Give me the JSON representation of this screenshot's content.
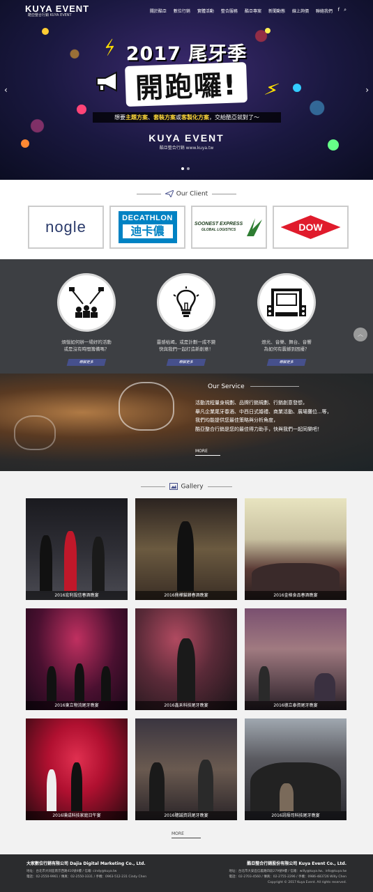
{
  "nav": {
    "logo": "KUYA EVENT",
    "logo_sub": "酷亞整合行銷 KUYA EVENT",
    "items": [
      "關於酷亞",
      "數位行銷",
      "實體活動",
      "整合服務",
      "酷亞專案",
      "新聞動態",
      "線上詢價",
      "聯絡我們"
    ],
    "icons": [
      "facebook-icon",
      "search-icon"
    ]
  },
  "hero": {
    "title": "2017 尾牙季",
    "big": "開跑囉!",
    "strip_pre": "想要",
    "strip_hl1": "主題方案",
    "strip_sep1": "、",
    "strip_hl2": "套裝方案",
    "strip_mid": "或",
    "strip_hl3": "客製化方案",
    "strip_post": "，交給酷亞就對了～",
    "brand": "KUYA EVENT",
    "brand_sub": "酷亞整合行銷 www.kuya.tw",
    "prev": "‹",
    "next": "›"
  },
  "client": {
    "title": "Our Client",
    "logos": {
      "nogle": "nogle",
      "deca_top": "DECATHLON",
      "deca_bottom": "迪卡儂",
      "soonest_1": "SOONEST EXPRESS",
      "soonest_2": "GLOBAL LOGISTICS",
      "dow": "DOW"
    }
  },
  "features": [
    {
      "desc1": "煩惱如何辦一場好的活動",
      "desc2": "或是沒有時間籌備嗎？",
      "btn": "瞭解更多"
    },
    {
      "desc1": "靈感枯竭，或是計劃一成不變",
      "desc2": "快與我們一起打造新創意！",
      "btn": "瞭解更多"
    },
    {
      "desc1": "燈光、音樂、舞台、音響",
      "desc2": "為如何有震撼到困擾？",
      "btn": "瞭解更多"
    }
  ],
  "service": {
    "title": "Our Service",
    "lines": [
      "活動流程量身規劃、品牌行銷規劃、行銷創意發想，",
      "舉凡企業尾牙春酒、中西日式婚禮、商業活動、展場攤位...等，",
      "我們均能提供您最佳策略與分析角度，",
      "酷亞整合行銷是您的最佳得力助手，快與我們一起同樂吧！"
    ],
    "more": "MORE"
  },
  "gallery": {
    "title": "Gallery",
    "items": [
      "2016宏利投信春酒晚宴",
      "2016鼎樺貓鋒春酒晚宴",
      "2016金格食品春酒晚宴",
      "2016東立物流尾牙晚宴",
      "2016鑫禾科技尾牙晚宴",
      "2016德立泰資尾牙晚宴",
      "2016璞成科技家庭日午宴",
      "2016聰誠資訊尾牙晚宴",
      "2016訊梧司科技尾牙晚宴"
    ],
    "more": "MORE"
  },
  "footer": {
    "left_title": "大家數位行銷有限公司 Dajia Digital Marketing Co., Ltd.",
    "left_line1": "地址：台北市大同區南京西路410號4樓 / 信箱: cindy@kuya.tw",
    "left_line2": "電話：02-2550-9961 / 傳真：02-2550-3331 / 手機：0963-512-231 Cindy Chen",
    "right_title": "酷亞整合行銷股份有限公司 Kuya Event Co., Ltd.",
    "right_line1": "地址：台北市大安區信義路四段279號9樓 / 信箱：willy@kuya.tw、info@kuya.tw",
    "right_line2": "電話：02-2703-4560 / 傳真：02-2755-2296 / 手機：0986-483726 Willy Chen",
    "copyright": "Copyright © 2017 Kuya Event. All rights reserved."
  }
}
